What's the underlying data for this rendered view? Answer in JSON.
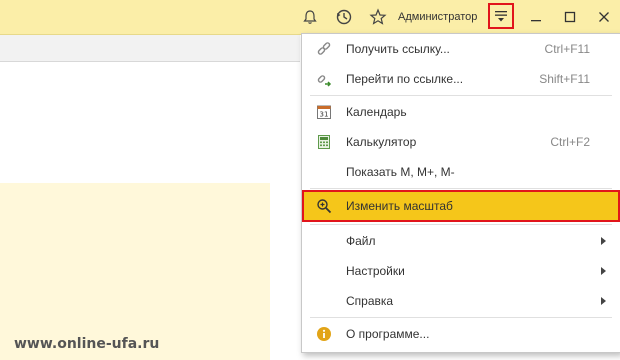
{
  "titlebar": {
    "user_name": "Администратор",
    "icons": [
      "bell-icon",
      "history-icon",
      "star-icon",
      "menu-icon",
      "minimize-icon",
      "maximize-icon",
      "close-icon"
    ]
  },
  "menu": {
    "items": [
      {
        "label": "Получить ссылку...",
        "shortcut": "Ctrl+F11",
        "icon": "link-icon"
      },
      {
        "label": "Перейти по ссылке...",
        "shortcut": "Shift+F11",
        "icon": "go-link-icon"
      },
      {
        "label": "Календарь",
        "shortcut": "",
        "icon": "calendar-icon"
      },
      {
        "label": "Калькулятор",
        "shortcut": "Ctrl+F2",
        "icon": "calculator-icon"
      },
      {
        "label": "Показать М, М+, М-",
        "shortcut": "",
        "icon": ""
      },
      {
        "label": "Изменить масштаб",
        "shortcut": "",
        "icon": "zoom-icon",
        "highlighted": true
      },
      {
        "label": "Файл",
        "submenu": true
      },
      {
        "label": "Настройки",
        "submenu": true
      },
      {
        "label": "Справка",
        "submenu": true
      },
      {
        "label": "О программе...",
        "shortcut": "",
        "icon": "info-icon"
      }
    ]
  },
  "watermark": "www.online-ufa.ru",
  "colors": {
    "titlebar_bg": "#fbeea8",
    "highlight": "#f5c61a",
    "annotation_red": "#e1141b",
    "workarea_yellow": "#fff8da"
  }
}
